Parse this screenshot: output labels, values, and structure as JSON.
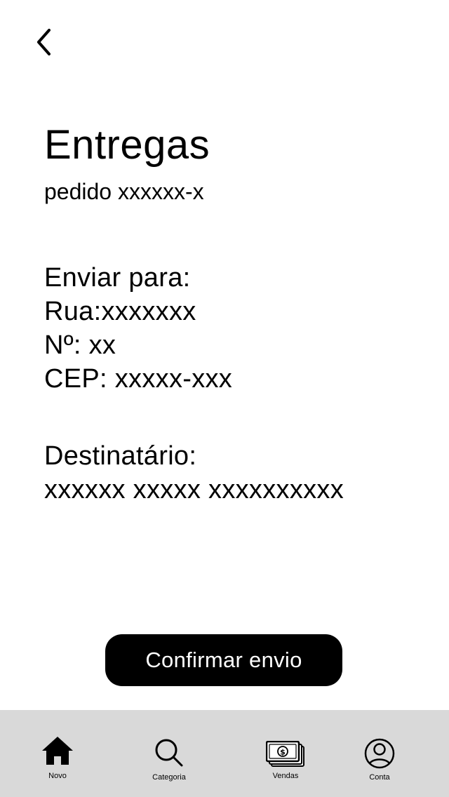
{
  "header": {
    "back_icon": "chevron-left-icon",
    "title": "Entregas",
    "subtitle": "pedido xxxxxx-x"
  },
  "shipping": {
    "heading": "Enviar para:",
    "street": "Rua:xxxxxxx",
    "number": "Nº: xx",
    "cep": "CEP: xxxxx-xxx"
  },
  "recipient": {
    "heading": "Destinatário:",
    "name": "xxxxxx xxxxx xxxxxxxxxx"
  },
  "actions": {
    "confirm_label": "Confirmar envio"
  },
  "bottom_nav": {
    "background": "#d9d9d9",
    "items": [
      {
        "label": "Novo",
        "icon": "home-icon"
      },
      {
        "label": "Categoria",
        "icon": "search-icon"
      },
      {
        "label": "Vendas",
        "icon": "money-icon"
      },
      {
        "label": "Conta",
        "icon": "user-circle-icon"
      }
    ]
  }
}
